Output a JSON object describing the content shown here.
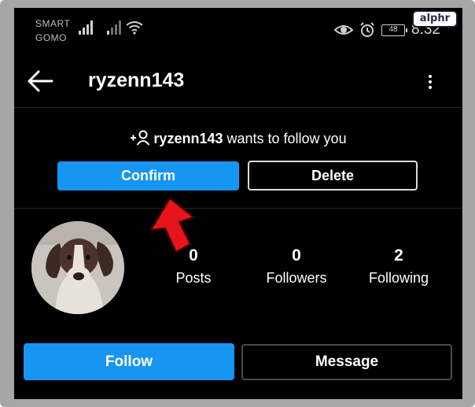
{
  "watermark": {
    "text": "alphr"
  },
  "status_bar": {
    "carrier_line1": "SMART",
    "carrier_line2": "GOMO",
    "battery": "48",
    "time": "8:32",
    "icons": [
      "signal-icon",
      "signal-icon",
      "wifi-icon",
      "eye-icon",
      "alarm-icon",
      "battery-icon"
    ]
  },
  "header": {
    "title": "ryzenn143",
    "back_icon": "back-arrow-icon",
    "menu_icon": "more-vertical-icon"
  },
  "follow_request": {
    "icon": "add-user-icon",
    "username": "ryzenn143",
    "message": "wants to follow you",
    "confirm_label": "Confirm",
    "delete_label": "Delete"
  },
  "annotation": {
    "icon": "red-pointer-arrow",
    "color": "#e8141b"
  },
  "profile": {
    "avatar": "dog-photo",
    "stats": [
      {
        "value": "0",
        "label": "Posts"
      },
      {
        "value": "0",
        "label": "Followers"
      },
      {
        "value": "2",
        "label": "Following"
      }
    ],
    "follow_label": "Follow",
    "message_label": "Message"
  },
  "colors": {
    "background": "#000000",
    "accent_blue": "#1795f2",
    "text": "#ffffff",
    "frame": "#a6a6a6"
  }
}
